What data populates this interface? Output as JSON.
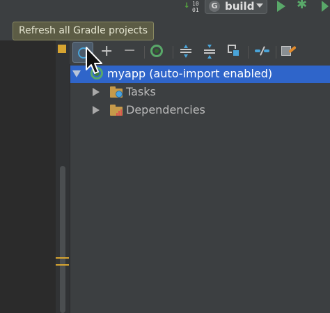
{
  "top_toolbar": {
    "bit_counter": "10 01",
    "build_combo": {
      "icon_glyph": "G",
      "label": "build"
    }
  },
  "tooltip": {
    "text": "Refresh all Gradle projects"
  },
  "gradle_toolbar": {
    "plus_glyph": "+",
    "minus_glyph": "−"
  },
  "tree": {
    "root": {
      "label": "myapp (auto-import enabled)",
      "expanded": true,
      "selected": true
    },
    "children": [
      {
        "label": "Tasks",
        "expanded": false
      },
      {
        "label": "Dependencies",
        "expanded": false
      }
    ]
  },
  "colors": {
    "selection": "#2f65ca",
    "gradle_green": "#59a869",
    "tooltip_bg": "#5c5c45",
    "panel_bg": "#3c3f41",
    "editor_bg": "#2b2b2b"
  }
}
